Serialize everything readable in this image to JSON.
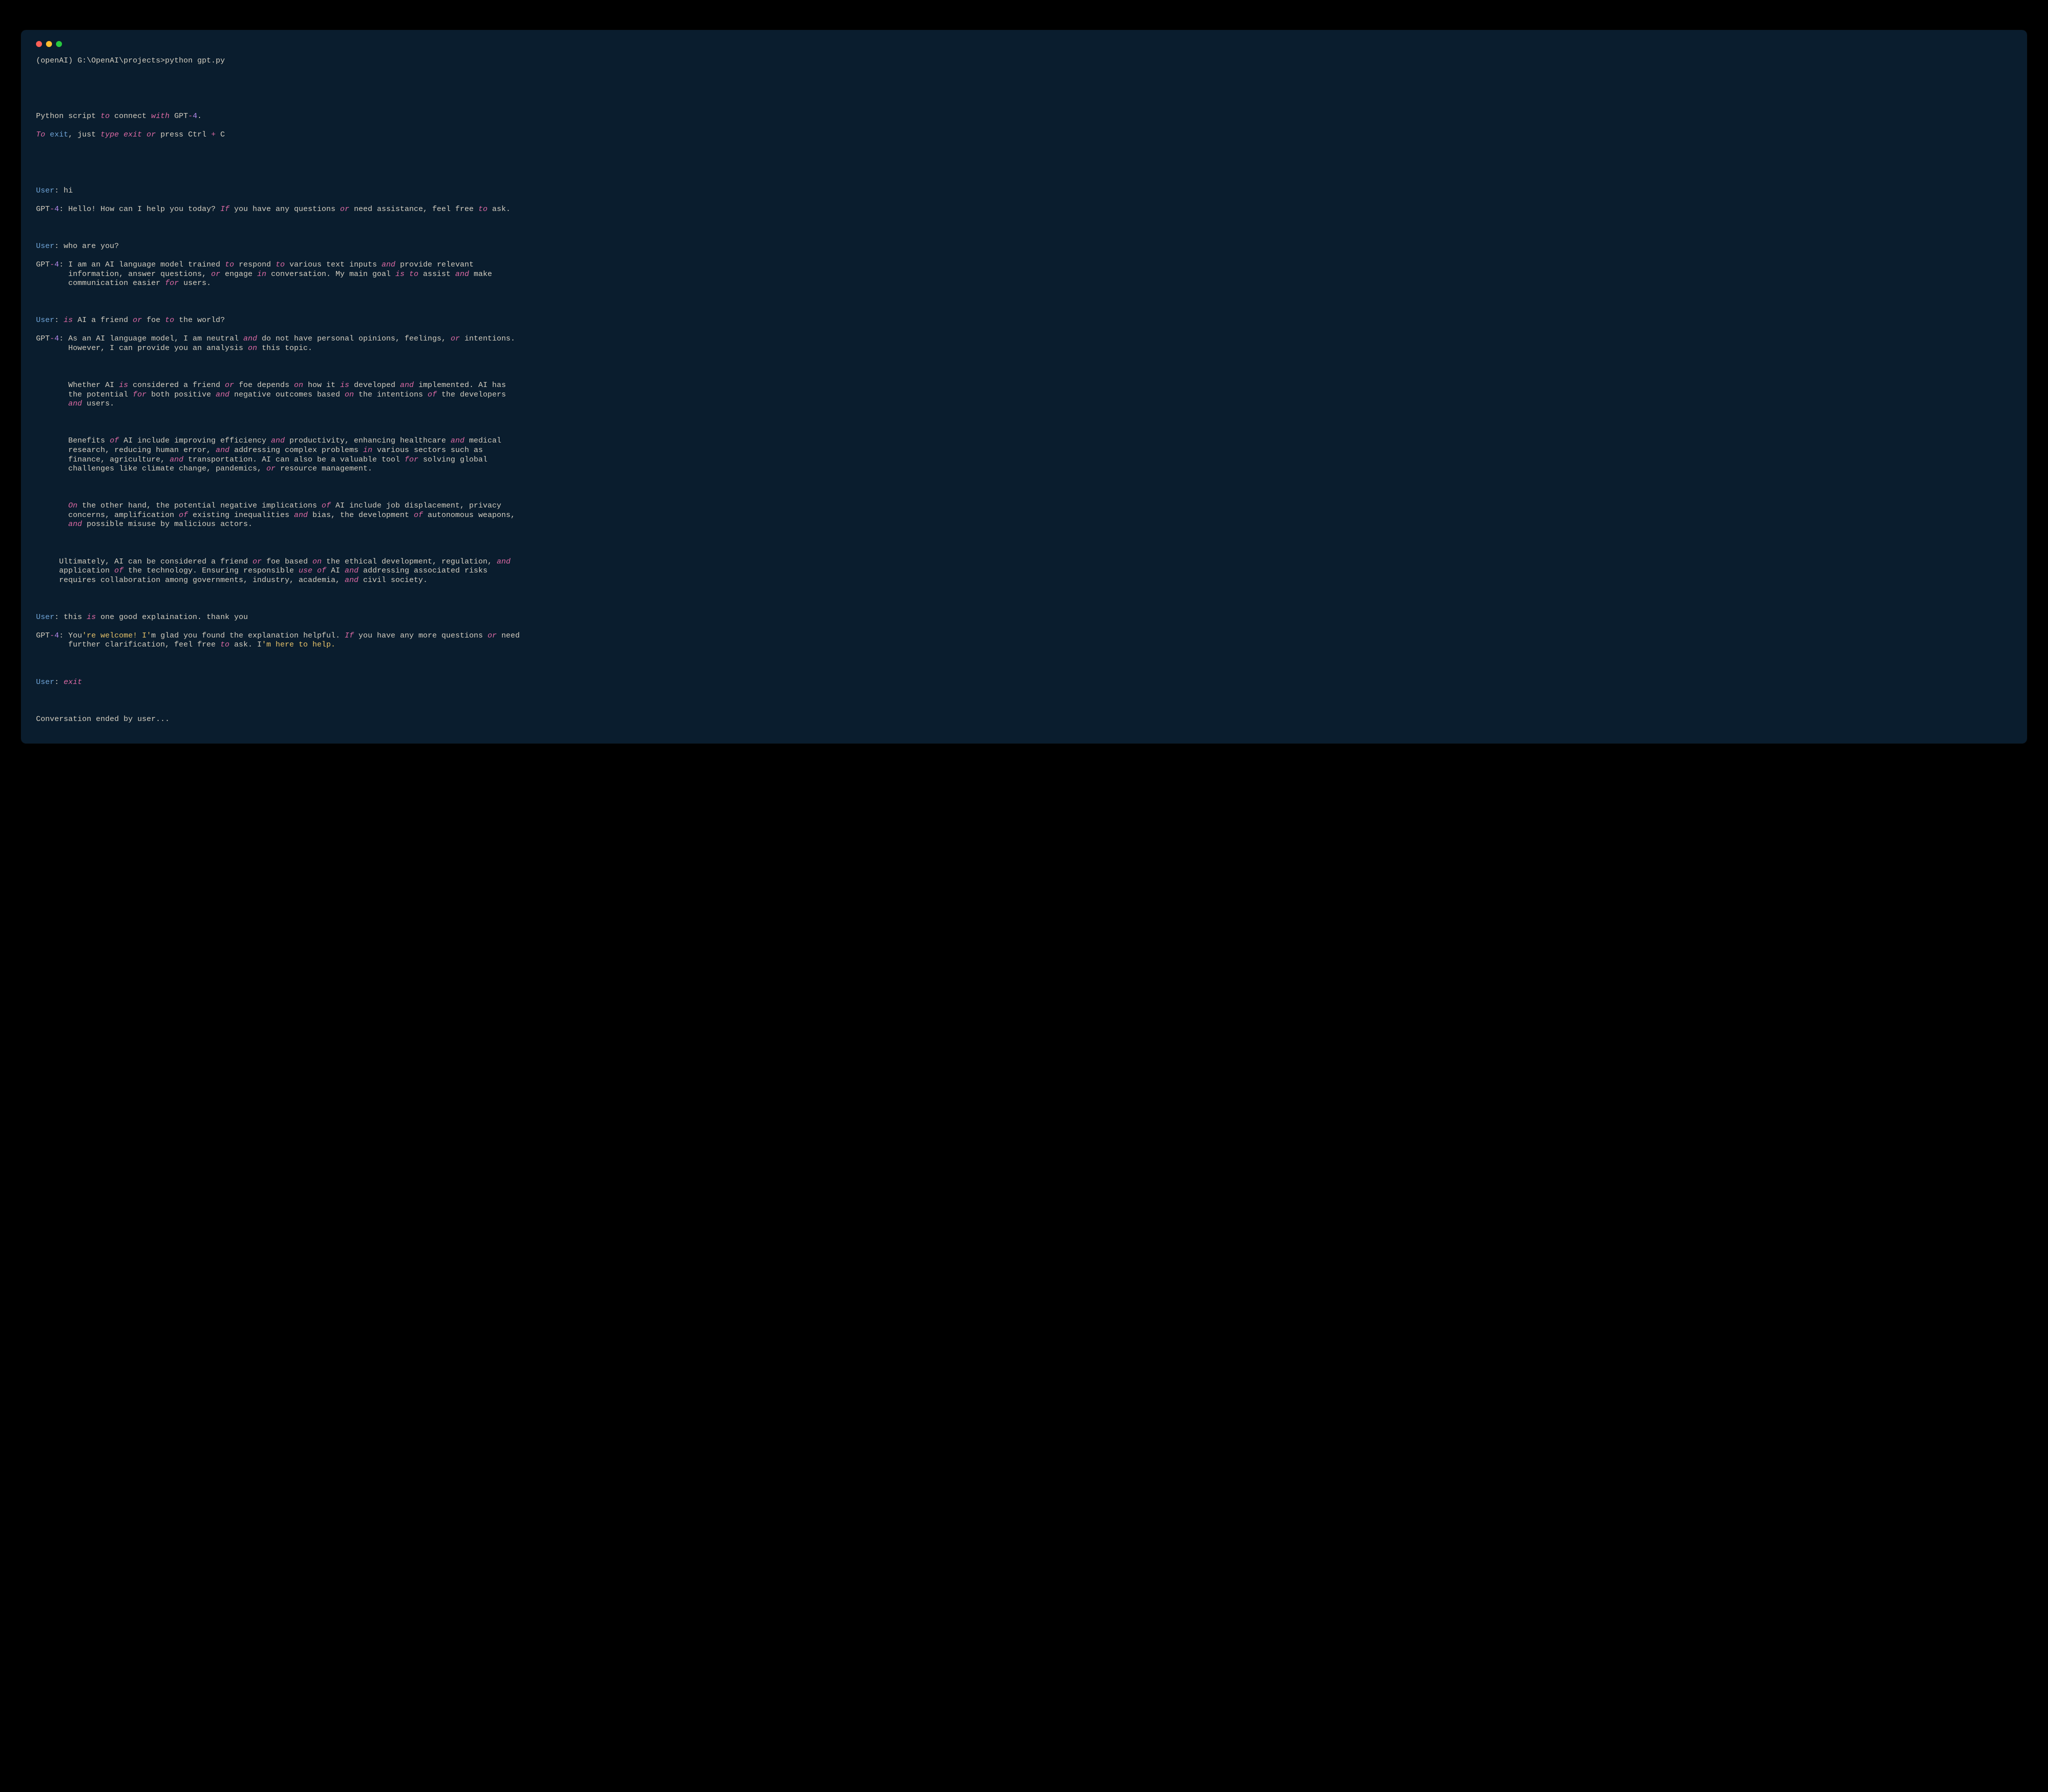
{
  "prompt": {
    "env": "(openAI) ",
    "path": "G:\\OpenAI\\projects>",
    "cmd": "python gpt.py"
  },
  "intro": {
    "l1_a": "Python script ",
    "l1_to": "to",
    "l1_b": " connect ",
    "l1_with": "with",
    "l1_c": " GPT",
    "l1_dash": "-",
    "l1_4": "4",
    "l1_dot": ".",
    "l2_To": "To",
    "l2_a": " ",
    "l2_exit": "exit",
    "l2_b": ", just ",
    "l2_type": "type",
    "l2_c": " ",
    "l2_exit2": "exit",
    "l2_d": " ",
    "l2_or": "or",
    "l2_e": " press Ctrl ",
    "l2_plus": "+",
    "l2_f": " C"
  },
  "labels": {
    "user": "User",
    "gpt_prefix": "GPT",
    "colon": ": ",
    "dash": "-",
    "four": "4"
  },
  "t1": {
    "u": "hi",
    "g_a": "Hello! How can I help you today? ",
    "g_If": "If",
    "g_b": " you have any questions ",
    "g_or": "or",
    "g_c": " need assistance, feel free ",
    "g_to": "to",
    "g_d": " ask."
  },
  "t2": {
    "u": "who are you?",
    "g_a": "I am an AI language model trained ",
    "g_to1": "to",
    "g_b": " respond ",
    "g_to2": "to",
    "g_c": " various text inputs ",
    "g_and1": "and",
    "g_d": " provide relevant\n       information, answer questions, ",
    "g_or": "or",
    "g_e": " engage ",
    "g_in": "in",
    "g_f": " conversation. My main goal ",
    "g_is": "is",
    "g_g": " ",
    "g_to3": "to",
    "g_h": " assist ",
    "g_and2": "and",
    "g_i": " make\n       communication easier ",
    "g_for": "for",
    "g_j": " users."
  },
  "t3": {
    "u_a": "",
    "u_is": "is",
    "u_b": " AI a friend ",
    "u_or": "or",
    "u_c": " foe ",
    "u_to": "to",
    "u_d": " the world?",
    "p1_a": "As an AI language model, I am neutral ",
    "p1_and": "and",
    "p1_b": " do not have personal opinions, feelings, ",
    "p1_or": "or",
    "p1_c": " intentions.\n       However, I can provide you an analysis ",
    "p1_on": "on",
    "p1_d": " this topic.",
    "p2_a": "       Whether AI ",
    "p2_is1": "is",
    "p2_b": " considered a friend ",
    "p2_or": "or",
    "p2_c": " foe depends ",
    "p2_on": "on",
    "p2_d": " how it ",
    "p2_is2": "is",
    "p2_e": " developed ",
    "p2_and1": "and",
    "p2_f": " implemented. AI has\n       the potential ",
    "p2_for": "for",
    "p2_g": " both positive ",
    "p2_and2": "and",
    "p2_h": " negative outcomes based ",
    "p2_on2": "on",
    "p2_i": " the intentions ",
    "p2_of": "of",
    "p2_j": " the developers\n       ",
    "p2_and3": "and",
    "p2_k": " users.",
    "p3_a": "       Benefits ",
    "p3_of1": "of",
    "p3_b": " AI include improving efficiency ",
    "p3_and1": "and",
    "p3_c": " productivity, enhancing healthcare ",
    "p3_and2": "and",
    "p3_d": " medical\n       research, reducing human error, ",
    "p3_and3": "and",
    "p3_e": " addressing complex problems ",
    "p3_in": "in",
    "p3_f": " various sectors such as\n       finance, agriculture, ",
    "p3_and4": "and",
    "p3_g": " transportation. AI can also be a valuable tool ",
    "p3_for": "for",
    "p3_h": " solving global\n       challenges like climate change, pandemics, ",
    "p3_or": "or",
    "p3_i": " resource management.",
    "p4_On": "On",
    "p4_a": " the other hand, the potential negative implications ",
    "p4_of1": "of",
    "p4_b": " AI include job displacement, privacy\n       concerns, amplification ",
    "p4_of2": "of",
    "p4_c": " existing inequalities ",
    "p4_and1": "and",
    "p4_d": " bias, the development ",
    "p4_of3": "of",
    "p4_e": " autonomous weapons,\n       ",
    "p4_and2": "and",
    "p4_f": " possible misuse by malicious actors.",
    "p5_a": "     Ultimately, AI can be considered a friend ",
    "p5_or": "or",
    "p5_b": " foe based ",
    "p5_on": "on",
    "p5_c": " the ethical development, regulation, ",
    "p5_and1": "and",
    "p5_d": "\n     application ",
    "p5_of1": "of",
    "p5_e": " the technology. Ensuring responsible ",
    "p5_use": "use",
    "p5_f": " ",
    "p5_of2": "of",
    "p5_g": " AI ",
    "p5_and2": "and",
    "p5_h": " addressing associated risks\n     requires collaboration among governments, industry, academia, ",
    "p5_and3": "and",
    "p5_i": " civil society."
  },
  "t4": {
    "u_a": "this ",
    "u_is": "is",
    "u_b": " one good explaination. thank you",
    "g_a": "You",
    "g_str": "'re welcome! I'",
    "g_b": "m glad you found the explanation helpful. ",
    "g_If": "If",
    "g_c": " you have any more questions ",
    "g_or": "or",
    "g_d": " need\n       further clarification, feel free ",
    "g_to": "to",
    "g_e": " ask. I",
    "g_str2": "'m here to help."
  },
  "t5": {
    "u_exit": "exit"
  },
  "ended": "Conversation ended by user..."
}
